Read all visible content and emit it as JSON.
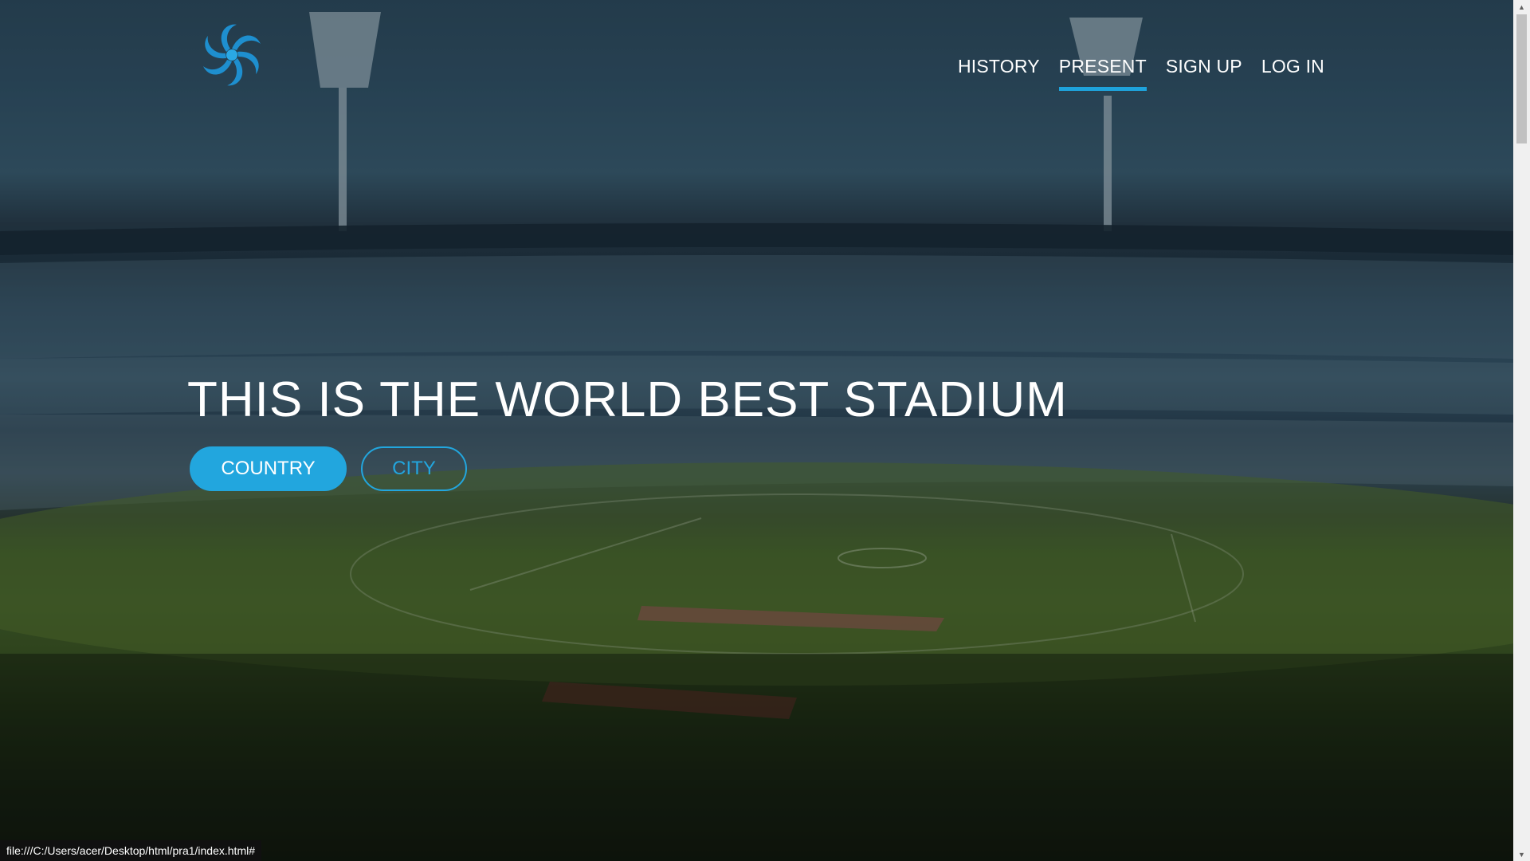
{
  "nav": {
    "items": [
      {
        "label": "HISTORY",
        "active": false
      },
      {
        "label": "PRESENT",
        "active": true
      },
      {
        "label": "SIGN UP",
        "active": false
      },
      {
        "label": "LOG IN",
        "active": false
      }
    ]
  },
  "hero": {
    "title": "THIS IS THE WORLD BEST STADIUM",
    "primary_button": "COUNTRY",
    "secondary_button": "CITY"
  },
  "status_bar": {
    "url": "file:///C:/Users/acer/Desktop/html/pra1/index.html#"
  },
  "logo": {
    "icon": "swirl-logo-icon"
  },
  "colors": {
    "accent": "#22a6de",
    "text": "#ffffff"
  }
}
